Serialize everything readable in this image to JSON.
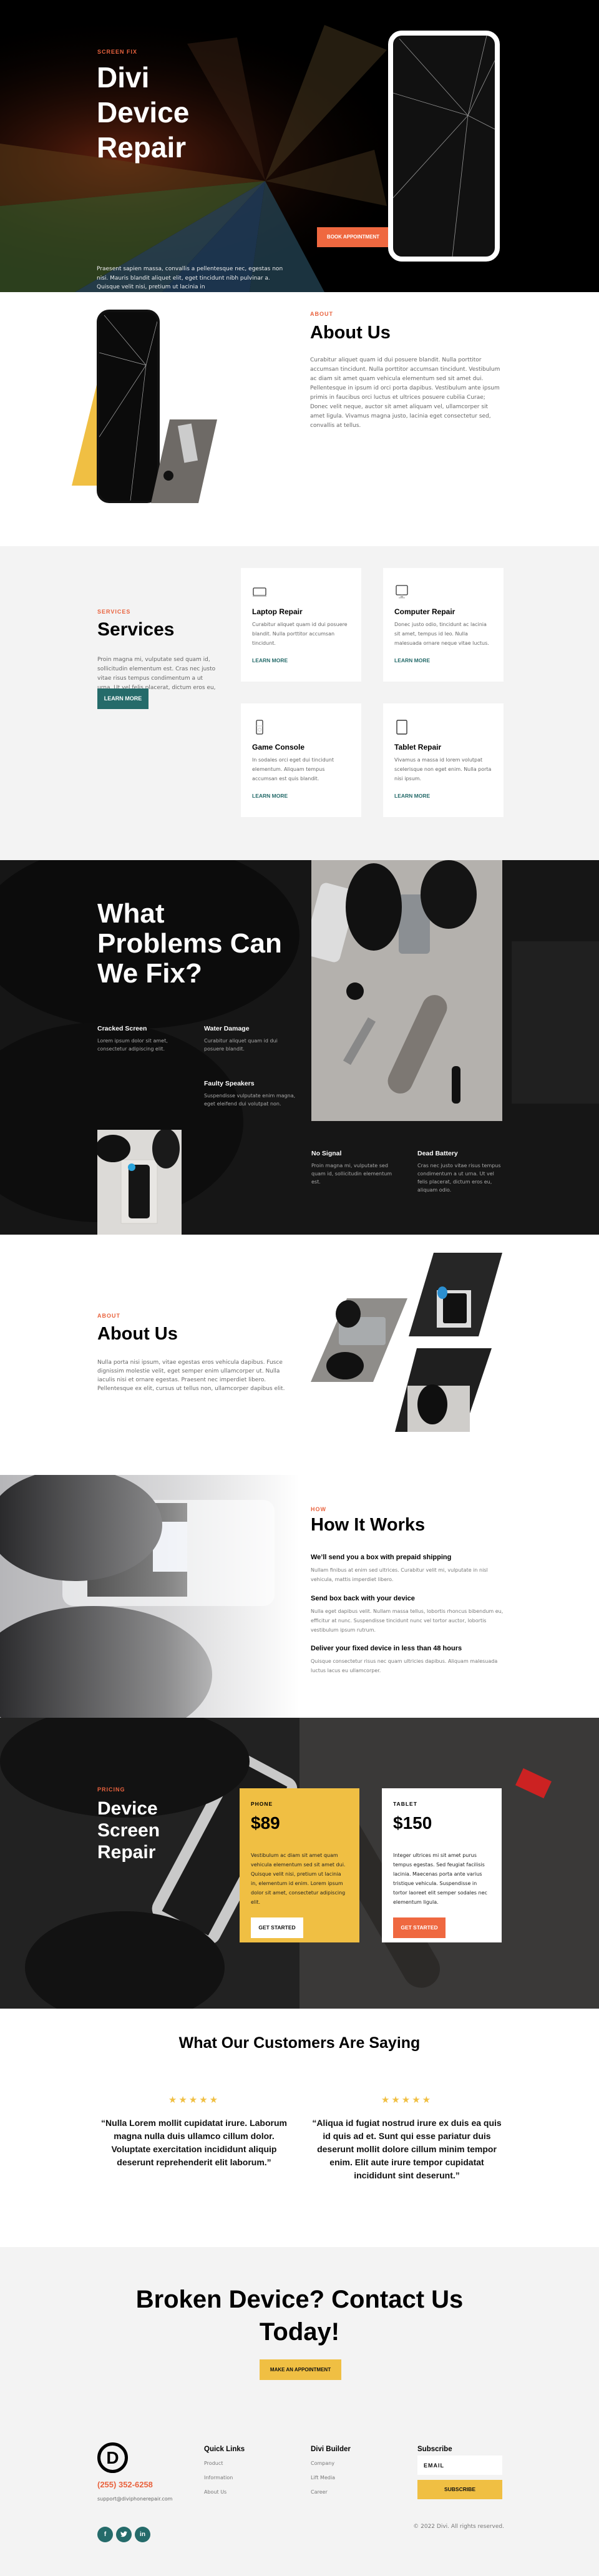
{
  "hero": {
    "eyebrow": "SCREEN FIX",
    "title": "Divi Device Repair",
    "text": "Praesent sapien massa, convallis a pellentesque nec, egestas non nisi. Mauris blandit aliquet elit, eget tincidunt nibh pulvinar a. Quisque velit nisi, pretium ut lacinia in",
    "button": "BOOK APPOINTMENT"
  },
  "about": {
    "eyebrow": "ABOUT",
    "title": "About Us",
    "text": "Curabitur aliquet quam id dui posuere blandit. Nulla porttitor accumsan tincidunt. Nulla porttitor accumsan tincidunt. Vestibulum ac diam sit amet quam vehicula elementum sed sit amet dui. Pellentesque in ipsum id orci porta dapibus. Vestibulum ante ipsum primis in faucibus orci luctus et ultrices posuere cubilia Curae; Donec velit neque, auctor sit amet aliquam vel, ullamcorper sit amet ligula. Vivamus magna justo, lacinia eget consectetur sed, convallis at tellus."
  },
  "services": {
    "eyebrow": "SERVICES",
    "title": "Services",
    "text": "Proin magna mi, vulputate sed quam id, sollicitudin elementum est. Cras nec justo vitae risus tempus condimentum a ut urna. Ut vel felis placerat, dictum eros eu, aliquam odio.",
    "button": "LEARN MORE",
    "cards": [
      {
        "icon": "laptop-icon",
        "title": "Laptop Repair",
        "text": "Curabitur aliquet quam id dui posuere blandit. Nulla porttitor accumsan tincidunt.",
        "link": "LEARN MORE"
      },
      {
        "icon": "computer-icon",
        "title": "Computer Repair",
        "text": "Donec justo odio, tincidunt ac lacinia sit amet, tempus id leo. Nulla malesuada ornare neque vitae luctus.",
        "link": "LEARN MORE"
      },
      {
        "icon": "game-console-icon",
        "title": "Game Console",
        "text": "In sodales orci eget dui tincidunt elementum. Aliquam tempus accumsan est quis blandit.",
        "link": "LEARN MORE"
      },
      {
        "icon": "tablet-icon",
        "title": "Tablet Repair",
        "text": "Vivamus a massa id lorem volutpat scelerisque non eget enim. Nulla porta nisi ipsum.",
        "link": "LEARN MORE"
      }
    ]
  },
  "problems": {
    "title": "What Problems Can We Fix?",
    "items": [
      {
        "title": "Cracked Screen",
        "text": "Lorem ipsum dolor sit amet, consectetur adipiscing elit."
      },
      {
        "title": "Water Damage",
        "text": "Curabitur aliquet quam id dui posuere blandit."
      },
      {
        "title": "Faulty Speakers",
        "text": "Suspendisse vulputate enim magna, eget eleifend dui volutpat non."
      },
      {
        "title": "No Signal",
        "text": "Proin magna mi, vulputate sed quam id, sollicitudin elementum est."
      },
      {
        "title": "Dead Battery",
        "text": "Cras nec justo vitae risus tempus condimentum a ut urna. Ut vel felis placerat, dictum eros eu, aliquam odio."
      }
    ]
  },
  "about2": {
    "eyebrow": "ABOUT",
    "title": "About Us",
    "text": "Nulla porta nisi ipsum, vitae egestas eros vehicula dapibus. Fusce dignissim molestie velit, eget semper enim ullamcorper ut. Nulla iaculis nisi et ornare egestas. Praesent nec imperdiet libero. Pellentesque ex elit, cursus ut tellus non, ullamcorper dapibus elit."
  },
  "how": {
    "eyebrow": "HOW",
    "title": "How It Works",
    "steps": [
      {
        "title": "We’ll send you a box with prepaid shipping",
        "text": "Nullam finibus at enim sed ultrices. Curabitur velit mi, vulputate in nisl vehicula, mattis imperdiet libero."
      },
      {
        "title": "Send box back with your device",
        "text": "Nulla eget dapibus velit. Nullam massa tellus, lobortis rhoncus bibendum eu, efficitur at nunc. Suspendisse tincidunt nunc vel tortor auctor, lobortis vestibulum ipsum rutrum."
      },
      {
        "title": "Deliver your fixed device in less than 48 hours",
        "text": "Quisque consectetur risus nec quam ultricies dapibus. Aliquam malesuada luctus lacus eu ullamcorper."
      }
    ]
  },
  "pricing": {
    "eyebrow": "PRICING",
    "title": "Device Screen Repair",
    "plans": [
      {
        "tier": "PHONE",
        "price": "$89",
        "text": "Vestibulum ac diam sit amet quam vehicula elementum sed sit amet dui. Quisque velit nisi, pretium ut lacinia in, elementum id enim. Lorem ipsum dolor sit amet, consectetur adipiscing elit.",
        "button": "GET STARTED"
      },
      {
        "tier": "TABLET",
        "price": "$150",
        "text": "Integer ultrices mi sit amet purus tempus egestas. Sed feugiat facilisis lacinia. Maecenas porta ante varius tristique vehicula. Suspendisse in tortor laoreet elit semper sodales nec elementum ligula.",
        "button": "GET STARTED"
      }
    ]
  },
  "testimonials": {
    "title": "What Our Customers Are Saying",
    "items": [
      {
        "rating": 5,
        "stars": "★★★★★",
        "quote": "“Nulla Lorem mollit cupidatat irure. Laborum magna nulla duis ullamco cillum dolor. Voluptate exercitation incididunt aliquip deserunt reprehenderit elit laborum.”"
      },
      {
        "rating": 5,
        "stars": "★★★★★",
        "quote": "“Aliqua id fugiat nostrud irure ex duis ea quis id quis ad et. Sunt qui esse pariatur duis deserunt mollit dolore cillum minim tempor enim. Elit aute irure tempor cupidatat incididunt sint deserunt.”"
      }
    ]
  },
  "cta": {
    "title": "Broken Device? Contact Us Today!",
    "button": "MAKE AN APPOINTMENT"
  },
  "footer": {
    "logo_letter": "D",
    "phone": "(255) 352-6258",
    "email": "support@diviphonerepair.com",
    "social": [
      {
        "icon": "facebook-icon",
        "glyph": "f"
      },
      {
        "icon": "twitter-icon",
        "glyph": "t"
      },
      {
        "icon": "linkedin-icon",
        "glyph": "in"
      }
    ],
    "quick_links": {
      "title": "Quick Links",
      "items": [
        "Product",
        "Information",
        "About Us"
      ]
    },
    "builder": {
      "title": "Divi Builder",
      "items": [
        "Company",
        "Lift Media",
        "Career"
      ]
    },
    "subscribe": {
      "title": "Subscribe",
      "placeholder": "EMAIL",
      "button": "SUBSCRIBE"
    },
    "copyright": "© 2022 Divi. All rights reserved."
  },
  "colors": {
    "accent_orange": "#ef6840",
    "accent_yellow": "#f0bf43",
    "accent_teal": "#256b6a"
  }
}
